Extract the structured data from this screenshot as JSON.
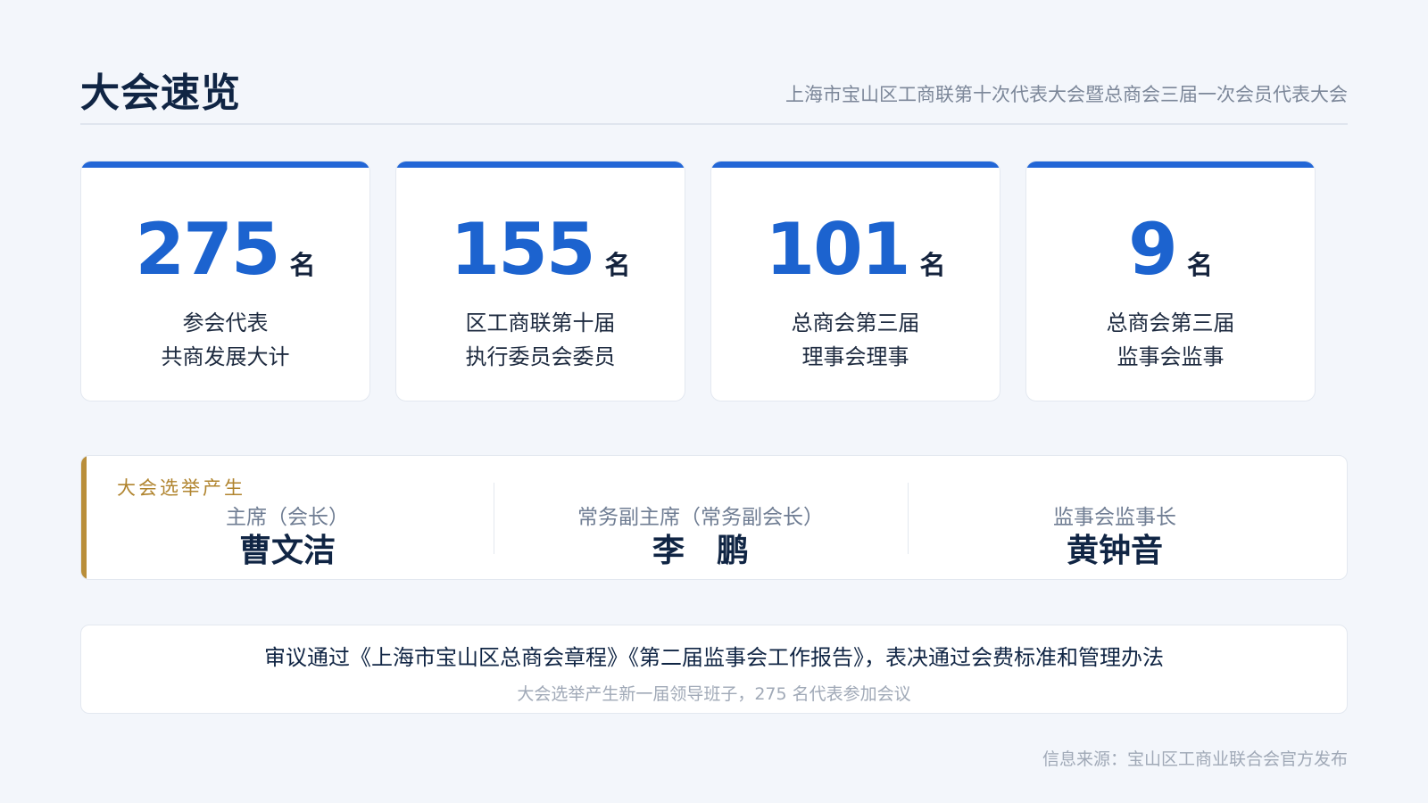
{
  "header": {
    "title": "大会速览",
    "subtitle": "上海市宝山区工商联第十次代表大会暨总商会三届一次会员代表大会"
  },
  "stats": [
    {
      "number": "275",
      "unit": "名",
      "line1": "参会代表",
      "line2": "共商发展大计"
    },
    {
      "number": "155",
      "unit": "名",
      "line1": "区工商联第十届",
      "line2": "执行委员会委员"
    },
    {
      "number": "101",
      "unit": "名",
      "line1": "总商会第三届",
      "line2": "理事会理事"
    },
    {
      "number": "9",
      "unit": "名",
      "line1": "总商会第三届",
      "line2": "监事会监事"
    }
  ],
  "election": {
    "label": "大会选举产生",
    "officers": [
      {
        "role": "主席（会长）",
        "name": "曹文洁"
      },
      {
        "role": "常务副主席（常务副会长）",
        "name": "李　鹏"
      },
      {
        "role": "监事会监事长",
        "name": "黄钟音"
      }
    ]
  },
  "resolution": {
    "main": "审议通过《上海市宝山区总商会章程》《第二届监事会工作报告》，表决通过会费标准和管理办法",
    "sub": "大会选举产生新一届领导班子，275 名代表参加会议"
  },
  "footer": {
    "source": "信息来源：宝山区工商业联合会官方发布"
  },
  "colors": {
    "accent": "#1c63cf",
    "gold": "#b98e3a",
    "background": "#f3f6fb"
  }
}
